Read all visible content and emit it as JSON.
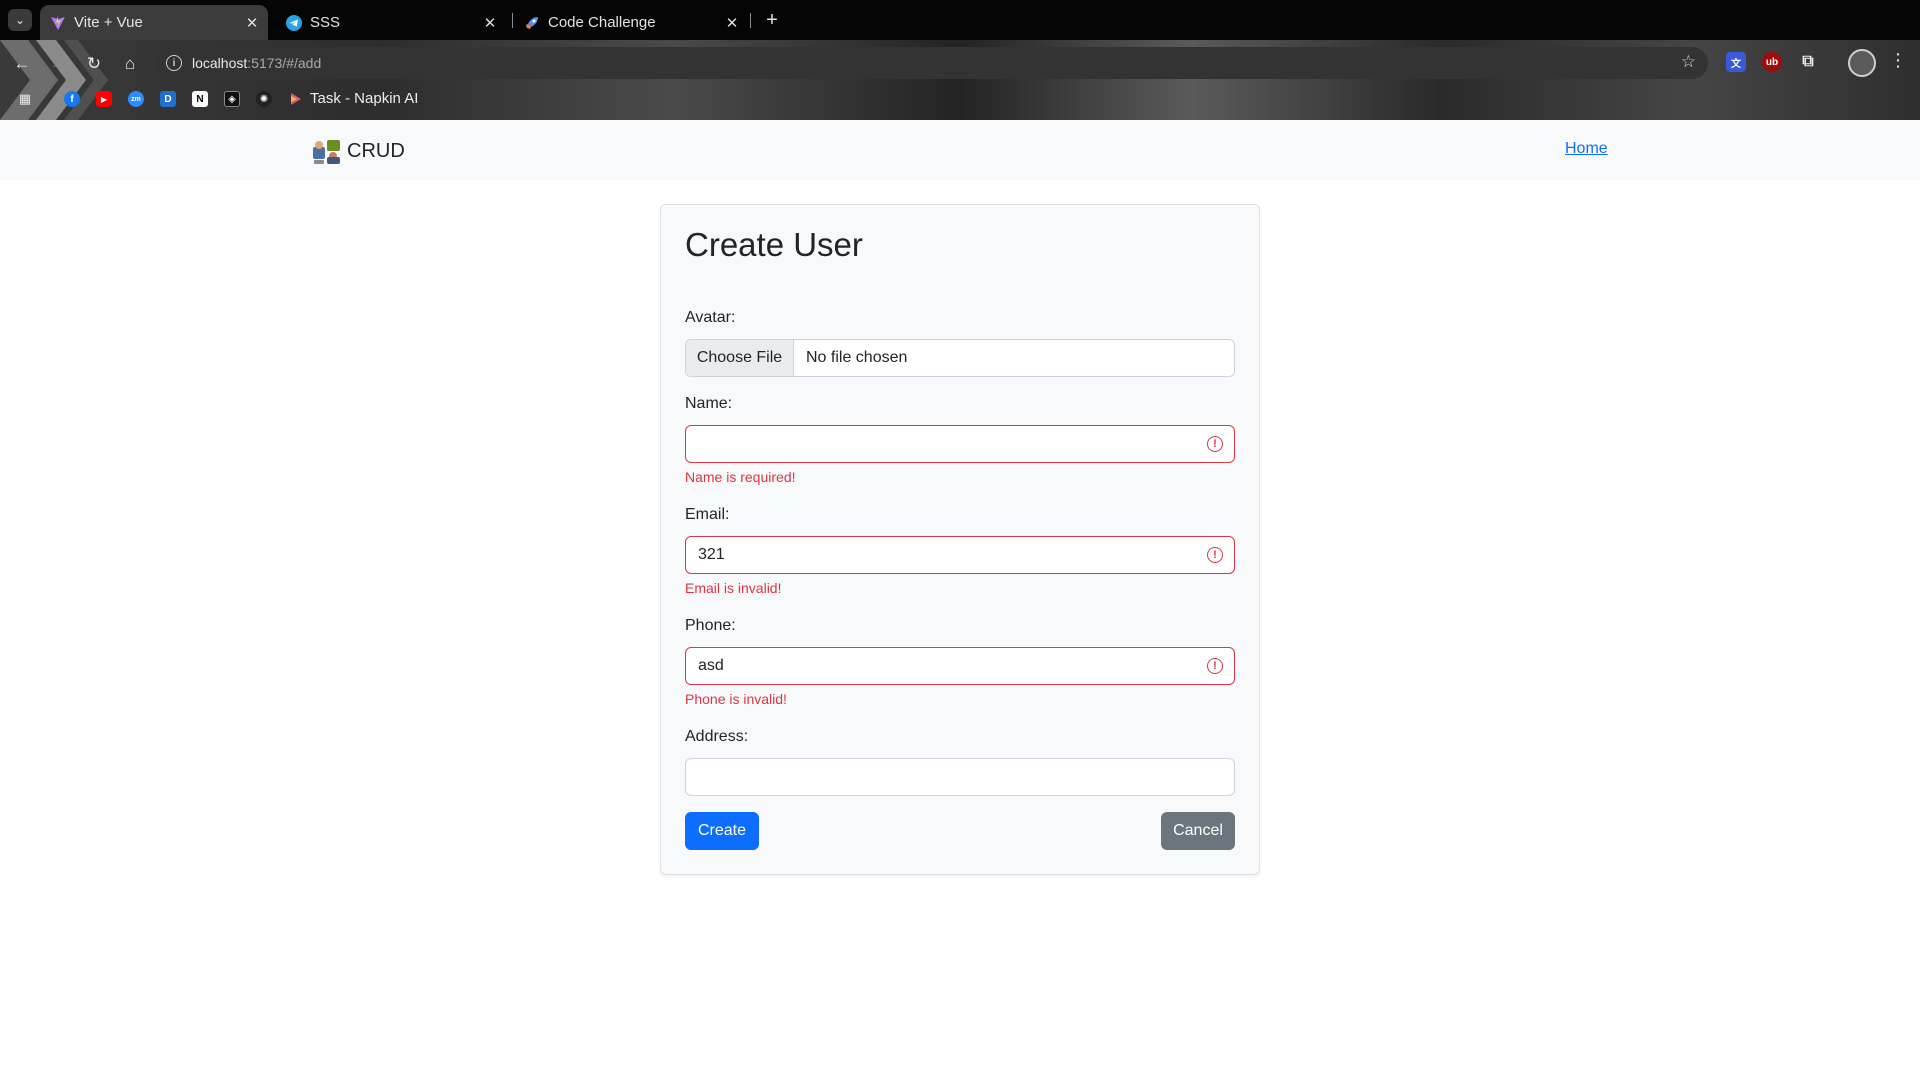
{
  "browser": {
    "tabs": [
      {
        "title": "Vite + Vue",
        "active": true
      },
      {
        "title": "SSS",
        "active": false
      },
      {
        "title": "Code Challenge",
        "active": false
      }
    ],
    "url_host": "localhost",
    "url_path": ":5173/#/add",
    "bookmark_label": "Task - Napkin AI",
    "icons": {
      "tab_list": "chevron-down-icon",
      "new_tab": "plus-icon",
      "back": "arrow-left-icon",
      "forward": "arrow-right-icon",
      "reload": "reload-icon",
      "home": "home-icon",
      "bookmark_star": "star-icon",
      "menu": "three-dots-icon"
    }
  },
  "navbar": {
    "brand": "CRUD",
    "home_link": "Home"
  },
  "form": {
    "title": "Create User",
    "avatar": {
      "label": "Avatar:",
      "button": "Choose File",
      "status": "No file chosen"
    },
    "name": {
      "label": "Name:",
      "value": "",
      "error": "Name is required!"
    },
    "email": {
      "label": "Email:",
      "value": "321",
      "error": "Email is invalid!"
    },
    "phone": {
      "label": "Phone:",
      "value": "asd",
      "error": "Phone is invalid!"
    },
    "address": {
      "label": "Address:",
      "value": ""
    },
    "create_label": "Create",
    "cancel_label": "Cancel"
  },
  "colors": {
    "primary": "#0d6efd",
    "secondary": "#6c757d",
    "danger": "#dc3545",
    "navbar_bg": "#f8f9fa"
  }
}
